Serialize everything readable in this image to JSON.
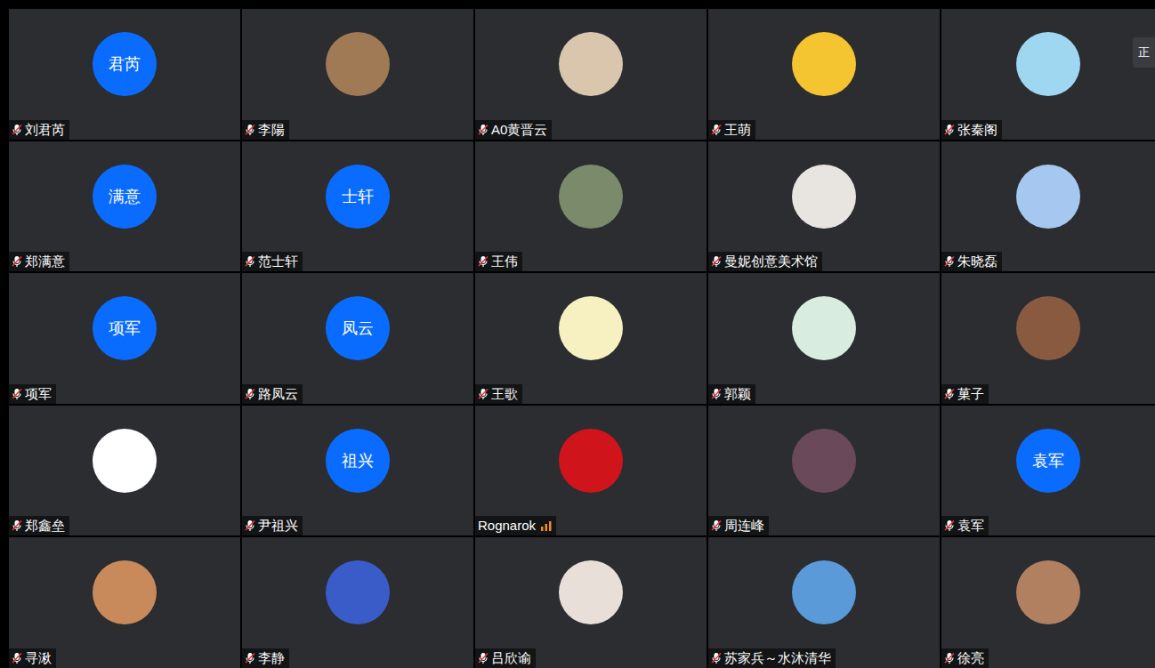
{
  "window": {
    "title": ""
  },
  "toast": {
    "text": "正"
  },
  "tiles": [
    {
      "name": "刘君芮",
      "muted": true,
      "avatar": {
        "kind": "initials",
        "text": "君芮"
      }
    },
    {
      "name": "李陽",
      "muted": true,
      "avatar": {
        "kind": "image",
        "color": "#a07a55"
      }
    },
    {
      "name": "A0黄晋云",
      "muted": true,
      "avatar": {
        "kind": "image",
        "color": "#d9c6ad"
      }
    },
    {
      "name": "王萌",
      "muted": true,
      "avatar": {
        "kind": "image",
        "color": "#f5c431"
      }
    },
    {
      "name": "张秦阁",
      "muted": true,
      "avatar": {
        "kind": "image",
        "color": "#9fd6f0"
      }
    },
    {
      "name": "郑满意",
      "muted": true,
      "avatar": {
        "kind": "initials",
        "text": "满意"
      }
    },
    {
      "name": "范士轩",
      "muted": true,
      "avatar": {
        "kind": "initials",
        "text": "士轩"
      }
    },
    {
      "name": "王伟",
      "muted": true,
      "avatar": {
        "kind": "image",
        "color": "#7a8a6a"
      }
    },
    {
      "name": "曼妮创意美术馆",
      "muted": true,
      "avatar": {
        "kind": "image",
        "color": "#e8e4e0"
      }
    },
    {
      "name": "朱晓磊",
      "muted": true,
      "avatar": {
        "kind": "image",
        "color": "#a6c7f0"
      }
    },
    {
      "name": "项军",
      "muted": true,
      "avatar": {
        "kind": "initials",
        "text": "项军"
      }
    },
    {
      "name": "路凤云",
      "muted": true,
      "avatar": {
        "kind": "initials",
        "text": "凤云"
      }
    },
    {
      "name": "王歌",
      "muted": true,
      "avatar": {
        "kind": "image",
        "color": "#f7f0c0"
      }
    },
    {
      "name": "郭颖",
      "muted": true,
      "avatar": {
        "kind": "image",
        "color": "#d8ece0"
      }
    },
    {
      "name": "菓子",
      "muted": true,
      "avatar": {
        "kind": "image",
        "color": "#8a5a40"
      }
    },
    {
      "name": "郑鑫垒",
      "muted": true,
      "avatar": {
        "kind": "image",
        "color": "#ffffff"
      }
    },
    {
      "name": "尹祖兴",
      "muted": true,
      "avatar": {
        "kind": "initials",
        "text": "祖兴"
      }
    },
    {
      "name": "Rognarok",
      "muted": false,
      "avatar": {
        "kind": "image",
        "color": "#d0141c"
      }
    },
    {
      "name": "周连峰",
      "muted": true,
      "avatar": {
        "kind": "image",
        "color": "#6a4a5a"
      }
    },
    {
      "name": "袁军",
      "muted": true,
      "avatar": {
        "kind": "initials",
        "text": "袁军"
      }
    },
    {
      "name": "寻湫",
      "muted": true,
      "avatar": {
        "kind": "image",
        "color": "#c88a5a"
      }
    },
    {
      "name": "李静",
      "muted": true,
      "avatar": {
        "kind": "image",
        "color": "#3a5cc8"
      }
    },
    {
      "name": "吕欣谕",
      "muted": true,
      "avatar": {
        "kind": "image",
        "color": "#e8e0d8"
      }
    },
    {
      "name": "苏家兵～水沐清华",
      "muted": true,
      "avatar": {
        "kind": "image",
        "color": "#5a9ad8"
      }
    },
    {
      "name": "徐亮",
      "muted": true,
      "avatar": {
        "kind": "image",
        "color": "#b08060"
      }
    }
  ]
}
